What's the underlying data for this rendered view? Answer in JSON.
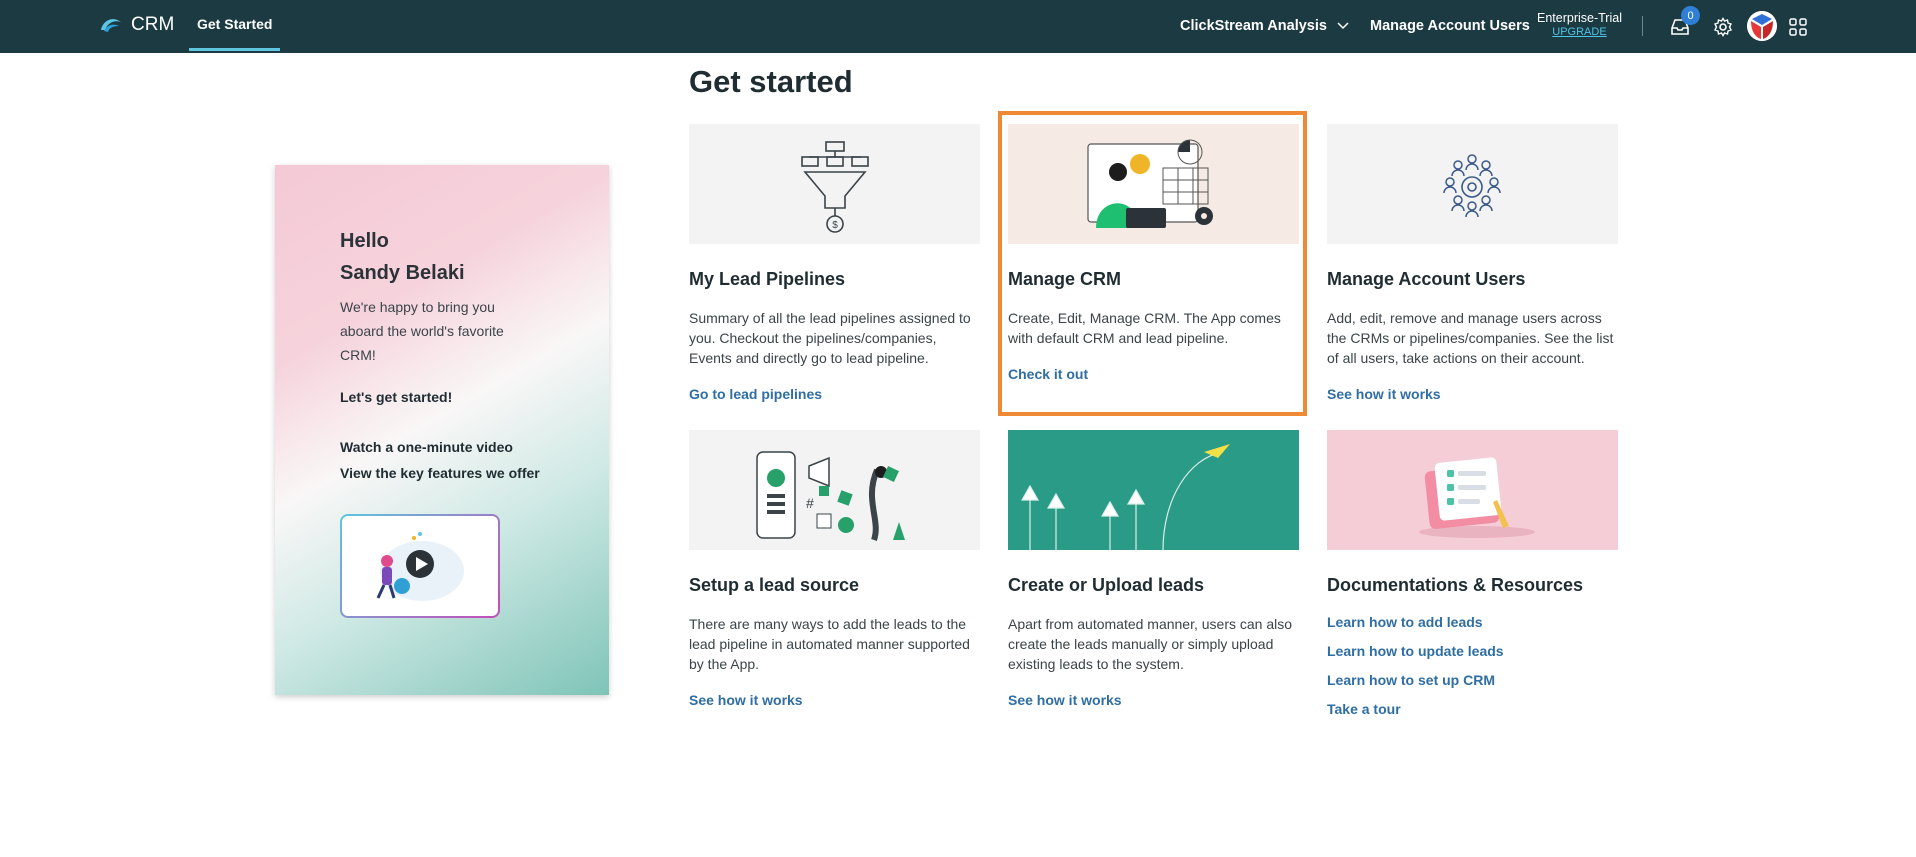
{
  "topbar": {
    "brand": "CRM",
    "tab": "Get Started",
    "workspace": "ClickStream Analysis",
    "manage_users": "Manage Account Users",
    "plan_name": "Enterprise-Trial",
    "plan_upgrade": "UPGRADE",
    "notification_count": "0"
  },
  "page_title": "Get started",
  "welcome": {
    "hello": "Hello",
    "user_name": "Sandy Belaki",
    "intro": "We're happy to bring you aboard the world's favorite CRM!",
    "lets_start": "Let's get started!",
    "watch_video": "Watch a one-minute video",
    "view_features": "View the key features we offer"
  },
  "cards": [
    {
      "title": "My Lead Pipelines",
      "description": "Summary of all the lead pipelines assigned to you. Checkout the pipelines/companies, Events and directly go to lead pipeline.",
      "link": "Go to lead pipelines"
    },
    {
      "title": "Manage CRM",
      "description": "Create, Edit, Manage CRM. The App comes with default CRM and lead pipeline.",
      "link": "Check it out"
    },
    {
      "title": "Manage Account Users",
      "description": "Add, edit, remove and manage users across the CRMs or pipelines/companies. See the list of all users, take actions on their account.",
      "link": "See how it works"
    },
    {
      "title": "Setup a lead source",
      "description": "There are many ways to add the leads to the lead pipeline in automated manner supported by the App.",
      "link": "See how it works"
    },
    {
      "title": "Create or Upload leads",
      "description": "Apart from automated manner, users can also create the leads manually or simply upload existing leads to the system.",
      "link": "See how it works"
    },
    {
      "title": "Documentations & Resources",
      "links": [
        "Learn how to add leads",
        "Learn how to update leads",
        "Learn how to set up CRM",
        "Take a tour"
      ]
    }
  ],
  "colors": {
    "topbar": "#1b3a42",
    "link": "#2f6ea3",
    "highlight": "#ee8a36",
    "badge": "#2f7fd6"
  }
}
